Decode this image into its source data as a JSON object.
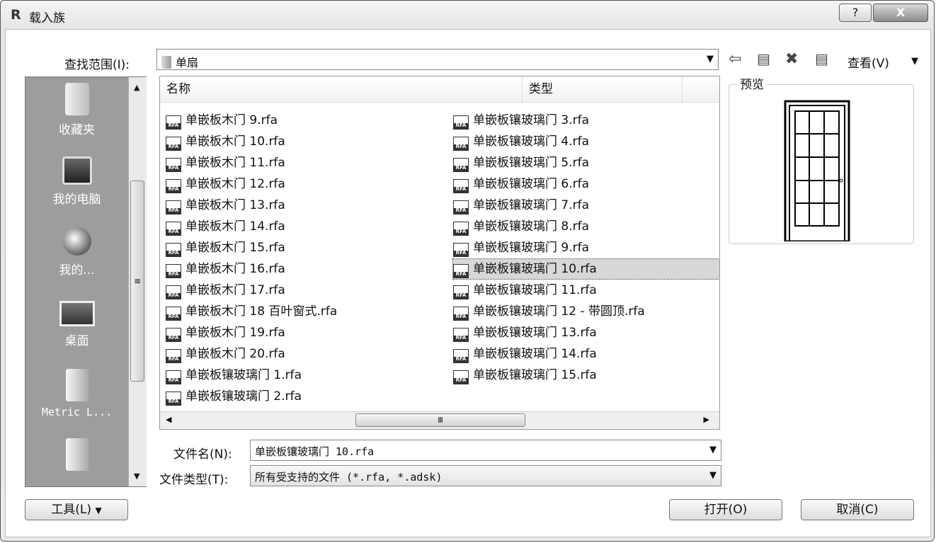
{
  "window": {
    "title": "载入族",
    "help_label": "?",
    "close_label": "X"
  },
  "toolbar": {
    "lookin_label": "查找范围(I):",
    "lookin_value": "单扇",
    "view_label": "查看(V)"
  },
  "places": [
    {
      "label": "收藏夹",
      "icon": "favorites-icon"
    },
    {
      "label": "我的电脑",
      "icon": "computer-icon"
    },
    {
      "label": "我的...",
      "icon": "network-icon"
    },
    {
      "label": "桌面",
      "icon": "desktop-icon"
    },
    {
      "label": "Metric L...",
      "icon": "folder-icon"
    },
    {
      "label": "",
      "icon": "folder-icon"
    }
  ],
  "columns": {
    "name": "名称",
    "type": "类型"
  },
  "files_left": [
    "单嵌板木门 9.rfa",
    "单嵌板木门 10.rfa",
    "单嵌板木门 11.rfa",
    "单嵌板木门 12.rfa",
    "单嵌板木门 13.rfa",
    "单嵌板木门 14.rfa",
    "单嵌板木门 15.rfa",
    "单嵌板木门 16.rfa",
    "单嵌板木门 17.rfa",
    "单嵌板木门 18 百叶窗式.rfa",
    "单嵌板木门 19.rfa",
    "单嵌板木门 20.rfa",
    "单嵌板镶玻璃门 1.rfa",
    "单嵌板镶玻璃门 2.rfa"
  ],
  "files_right": [
    "单嵌板镶玻璃门 3.rfa",
    "单嵌板镶玻璃门 4.rfa",
    "单嵌板镶玻璃门 5.rfa",
    "单嵌板镶玻璃门 6.rfa",
    "单嵌板镶玻璃门 7.rfa",
    "单嵌板镶玻璃门 8.rfa",
    "单嵌板镶玻璃门 9.rfa",
    "单嵌板镶玻璃门 10.rfa",
    "单嵌板镶玻璃门 11.rfa",
    "单嵌板镶玻璃门 12 - 带圆顶.rfa",
    "单嵌板镶玻璃门 13.rfa",
    "单嵌板镶玻璃门 14.rfa",
    "单嵌板镶玻璃门 15.rfa"
  ],
  "selected_file": "单嵌板镶玻璃门 10.rfa",
  "file_icon_text": "RFA",
  "filename": {
    "label": "文件名(N):",
    "value": "单嵌板镶玻璃门 10.rfa"
  },
  "filetype": {
    "label": "文件类型(T):",
    "value": "所有受支持的文件 (*.rfa, *.adsk)"
  },
  "preview": {
    "label": "预览"
  },
  "buttons": {
    "tools": "工具(L)",
    "open": "打开(O)",
    "cancel": "取消(C)"
  }
}
